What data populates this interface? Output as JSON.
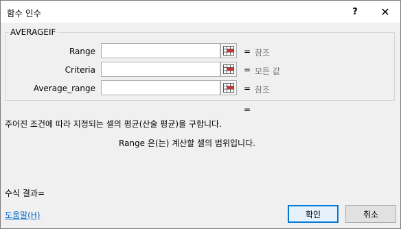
{
  "window": {
    "title": "함수 인수",
    "help_label": "?",
    "close_label": "✕"
  },
  "function": {
    "name": "AVERAGEIF"
  },
  "arguments": [
    {
      "label": "Range",
      "value": "",
      "eq": "=",
      "result": "참조"
    },
    {
      "label": "Criteria",
      "value": "",
      "eq": "=",
      "result": "모든 값"
    },
    {
      "label": "Average_range",
      "value": "",
      "eq": "=",
      "result": "참조"
    }
  ],
  "result_eq": "=",
  "description": "주어진 조건에 따라 지정되는 셀의 평균(산술 평균)을 구합니다.",
  "arg_description": "Range  은(는) 계산할 셀의 범위입니다.",
  "formula_result_label": "수식 결과=",
  "help_link": "도움말(H)",
  "buttons": {
    "ok": "확인",
    "cancel": "취소"
  }
}
